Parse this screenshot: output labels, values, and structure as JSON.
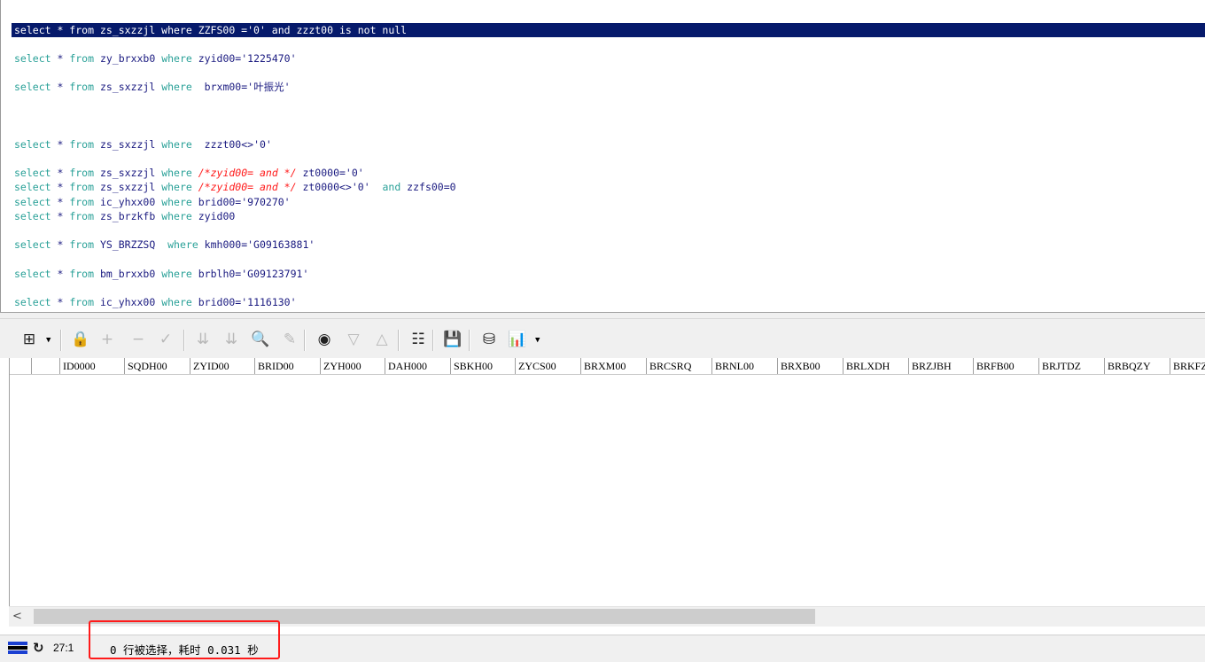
{
  "editor": {
    "lines": [
      {
        "selected": true,
        "parts": [
          {
            "t": "select * from zs_sxzzjl where ZZFS00 ='0' and zzzt00 is not null",
            "c": "id"
          }
        ]
      },
      {
        "parts": [
          {
            "t": "select",
            "c": "kw"
          },
          {
            "t": " * ",
            "c": "id"
          },
          {
            "t": "from",
            "c": "kw"
          },
          {
            "t": " zy_brxxb0 ",
            "c": "id"
          },
          {
            "t": "where",
            "c": "kw"
          },
          {
            "t": " zyid00='1225470'",
            "c": "str"
          }
        ]
      },
      {
        "parts": [
          {
            "t": "select",
            "c": "kw"
          },
          {
            "t": " * ",
            "c": "id"
          },
          {
            "t": "from",
            "c": "kw"
          },
          {
            "t": " zs_sxzzjl ",
            "c": "id"
          },
          {
            "t": "where",
            "c": "kw"
          },
          {
            "t": "  brxm00='叶振光'",
            "c": "str"
          }
        ]
      },
      {
        "parts": [
          {
            "t": "select",
            "c": "kw"
          },
          {
            "t": " * ",
            "c": "id"
          },
          {
            "t": "from",
            "c": "kw"
          },
          {
            "t": " zs_sxzzjl ",
            "c": "id"
          },
          {
            "t": "where",
            "c": "kw"
          },
          {
            "t": "  zzzt00<>'0'",
            "c": "str"
          }
        ]
      },
      {
        "parts": [
          {
            "t": "select",
            "c": "kw"
          },
          {
            "t": " * ",
            "c": "id"
          },
          {
            "t": "from",
            "c": "kw"
          },
          {
            "t": " zs_sxzzjl ",
            "c": "id"
          },
          {
            "t": "where",
            "c": "kw"
          },
          {
            "t": " /*zyid00= and */",
            "c": "cmt"
          },
          {
            "t": " zt0000='0'",
            "c": "str"
          }
        ]
      },
      {
        "parts": [
          {
            "t": "select",
            "c": "kw"
          },
          {
            "t": " * ",
            "c": "id"
          },
          {
            "t": "from",
            "c": "kw"
          },
          {
            "t": " zs_sxzzjl ",
            "c": "id"
          },
          {
            "t": "where",
            "c": "kw"
          },
          {
            "t": " /*zyid00= and */",
            "c": "cmt"
          },
          {
            "t": " zt0000<>'0' ",
            "c": "str"
          },
          {
            "t": " and",
            "c": "kw"
          },
          {
            "t": " zzfs00=0",
            "c": "id"
          }
        ]
      },
      {
        "parts": [
          {
            "t": "select",
            "c": "kw"
          },
          {
            "t": " * ",
            "c": "id"
          },
          {
            "t": "from",
            "c": "kw"
          },
          {
            "t": " ic_yhxx00 ",
            "c": "id"
          },
          {
            "t": "where",
            "c": "kw"
          },
          {
            "t": " brid00='970270'",
            "c": "str"
          }
        ]
      },
      {
        "parts": [
          {
            "t": "select",
            "c": "kw"
          },
          {
            "t": " * ",
            "c": "id"
          },
          {
            "t": "from",
            "c": "kw"
          },
          {
            "t": " zs_brzkfb ",
            "c": "id"
          },
          {
            "t": "where",
            "c": "kw"
          },
          {
            "t": " zyid00",
            "c": "id"
          }
        ]
      },
      {
        "parts": [
          {
            "t": "select",
            "c": "kw"
          },
          {
            "t": " * ",
            "c": "id"
          },
          {
            "t": "from",
            "c": "kw"
          },
          {
            "t": " YS_BRZZSQ  ",
            "c": "id"
          },
          {
            "t": "where",
            "c": "kw"
          },
          {
            "t": " kmh000='G09163881'",
            "c": "str"
          }
        ]
      },
      {
        "parts": [
          {
            "t": "select",
            "c": "kw"
          },
          {
            "t": " * ",
            "c": "id"
          },
          {
            "t": "from",
            "c": "kw"
          },
          {
            "t": " bm_brxxb0 ",
            "c": "id"
          },
          {
            "t": "where",
            "c": "kw"
          },
          {
            "t": " brblh0='G09123791'",
            "c": "str"
          }
        ]
      },
      {
        "parts": [
          {
            "t": "select",
            "c": "kw"
          },
          {
            "t": " * ",
            "c": "id"
          },
          {
            "t": "from",
            "c": "kw"
          },
          {
            "t": " ic_yhxx00 ",
            "c": "id"
          },
          {
            "t": "where",
            "c": "kw"
          },
          {
            "t": " brid00='1116130'",
            "c": "str"
          }
        ]
      }
    ]
  },
  "toolbar": {
    "buttons": [
      {
        "name": "grid-layout-icon",
        "glyph": "⊞",
        "enabled": true
      },
      {
        "name": "lock-icon",
        "glyph": "🔒",
        "enabled": true
      },
      {
        "name": "add-row-icon",
        "glyph": "+",
        "enabled": false
      },
      {
        "name": "delete-row-icon",
        "glyph": "−",
        "enabled": false
      },
      {
        "name": "post-edit-icon",
        "glyph": "✓",
        "enabled": false
      },
      {
        "name": "apply-filter-icon",
        "glyph": "⇊",
        "enabled": false
      },
      {
        "name": "clear-filter-icon",
        "glyph": "⇊",
        "enabled": false
      },
      {
        "name": "find-icon",
        "glyph": "🔍",
        "enabled": true
      },
      {
        "name": "eraser-icon",
        "glyph": "✎",
        "enabled": false
      },
      {
        "name": "record-nav-icon",
        "glyph": "◉",
        "enabled": true
      },
      {
        "name": "move-down-icon",
        "glyph": "▽",
        "enabled": false
      },
      {
        "name": "move-up-icon",
        "glyph": "△",
        "enabled": false
      },
      {
        "name": "tree-view-icon",
        "glyph": "☷",
        "enabled": true
      },
      {
        "name": "save-icon",
        "glyph": "💾",
        "enabled": true
      },
      {
        "name": "database-icon",
        "glyph": "⛁",
        "enabled": true
      },
      {
        "name": "chart-icon",
        "glyph": "📊",
        "enabled": true
      }
    ]
  },
  "grid": {
    "columns": [
      "ID0000",
      "SQDH00",
      "ZYID00",
      "BRID00",
      "ZYH000",
      "DAH000",
      "SBKH00",
      "ZYCS00",
      "BRXM00",
      "BRCSRQ",
      "BRNL00",
      "BRXB00",
      "BRLXDH",
      "BRZJBH",
      "BRFB00",
      "BRJTDZ",
      "BRBQZY",
      "BRKFZ"
    ],
    "rows": []
  },
  "status": {
    "cursor_position": "27:1",
    "message": "0 行被选择，耗时 0.031 秒",
    "flag_colors": [
      "#1a3fd1",
      "#000000",
      "#1a3fd1"
    ],
    "highlight_color": "#ff1a1a"
  }
}
